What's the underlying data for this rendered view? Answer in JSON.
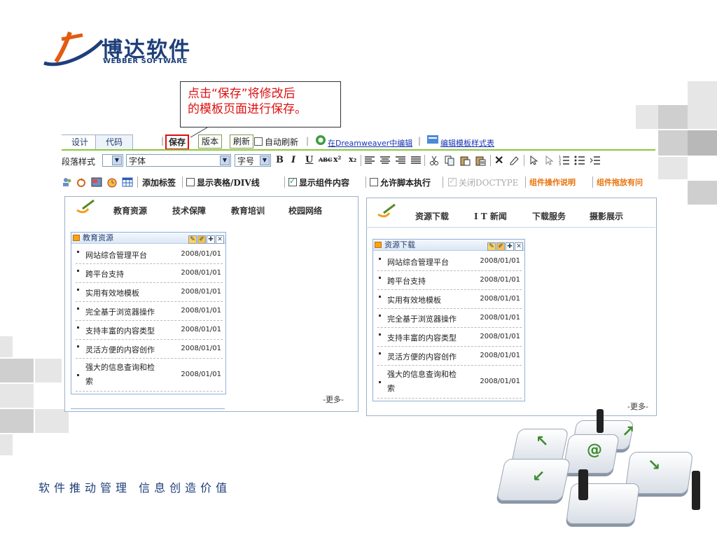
{
  "logo": {
    "cn": "博达软件",
    "en": "WEBBER SOFTWARE"
  },
  "callout": {
    "line1": "点击“保存”将修改后",
    "line2": "的模板页面进行保存。"
  },
  "tabs": {
    "design": "设计",
    "code": "代码"
  },
  "toolbar1": {
    "save": "保存",
    "version": "版本",
    "refresh": "刷新",
    "auto_refresh": "自动刷新",
    "dreamweaver": "在Dreamweaver中编辑",
    "edit_css": "编辑模板样式表"
  },
  "toolbar2": {
    "paragraph": "段落样式",
    "font": "字体",
    "size": "字号",
    "bold": "B",
    "italic": "I",
    "underline": "U",
    "strike": "ABC",
    "sup": "x²",
    "sub": "x₂"
  },
  "toolbar3": {
    "add_tag": "添加标签",
    "show_table": "显示表格/DIV线",
    "show_widget": "显示组件内容",
    "allow_script": "允许脚本执行",
    "close_doctype": "关闭DOCTYPE",
    "widget_help": "组件操作说明",
    "widget_drag": "组件拖放有问"
  },
  "left_panel": {
    "nav": [
      "教育资源",
      "技术保障",
      "教育培训",
      "校园网络"
    ],
    "widget_title": "教育资源",
    "items": [
      {
        "title": "网站综合管理平台",
        "date": "2008/01/01"
      },
      {
        "title": "跨平台支持",
        "date": "2008/01/01"
      },
      {
        "title": "实用有效地模板",
        "date": "2008/01/01"
      },
      {
        "title": "完全基于浏览器操作",
        "date": "2008/01/01"
      },
      {
        "title": "支持丰富的内容类型",
        "date": "2008/01/01"
      },
      {
        "title": "灵活方便的内容创作",
        "date": "2008/01/01"
      },
      {
        "title": "强大的信息查询和检",
        "title2": "索",
        "date": "2008/01/01"
      }
    ],
    "more": "-更多-"
  },
  "right_panel": {
    "nav": [
      "资源下载",
      "I T 新闻",
      "下载服务",
      "摄影展示"
    ],
    "widget_title": "资源下载",
    "items": [
      {
        "title": "网站综合管理平台",
        "date": "2008/01/01"
      },
      {
        "title": "跨平台支持",
        "date": "2008/01/01"
      },
      {
        "title": "实用有效地模板",
        "date": "2008/01/01"
      },
      {
        "title": "完全基于浏览器操作",
        "date": "2008/01/01"
      },
      {
        "title": "支持丰富的内容类型",
        "date": "2008/01/01"
      },
      {
        "title": "灵活方便的内容创作",
        "date": "2008/01/01"
      },
      {
        "title": "强大的信息查询和检",
        "title2": "索",
        "date": "2008/01/01"
      }
    ],
    "more": "-更多-"
  },
  "slogan": "软件推动管理 信息创造价值",
  "colors": {
    "brand": "#1e3f7a",
    "accent_red": "#dd1111",
    "toolbar_green": "#8dc63f",
    "link_blue": "#1a34b5"
  }
}
